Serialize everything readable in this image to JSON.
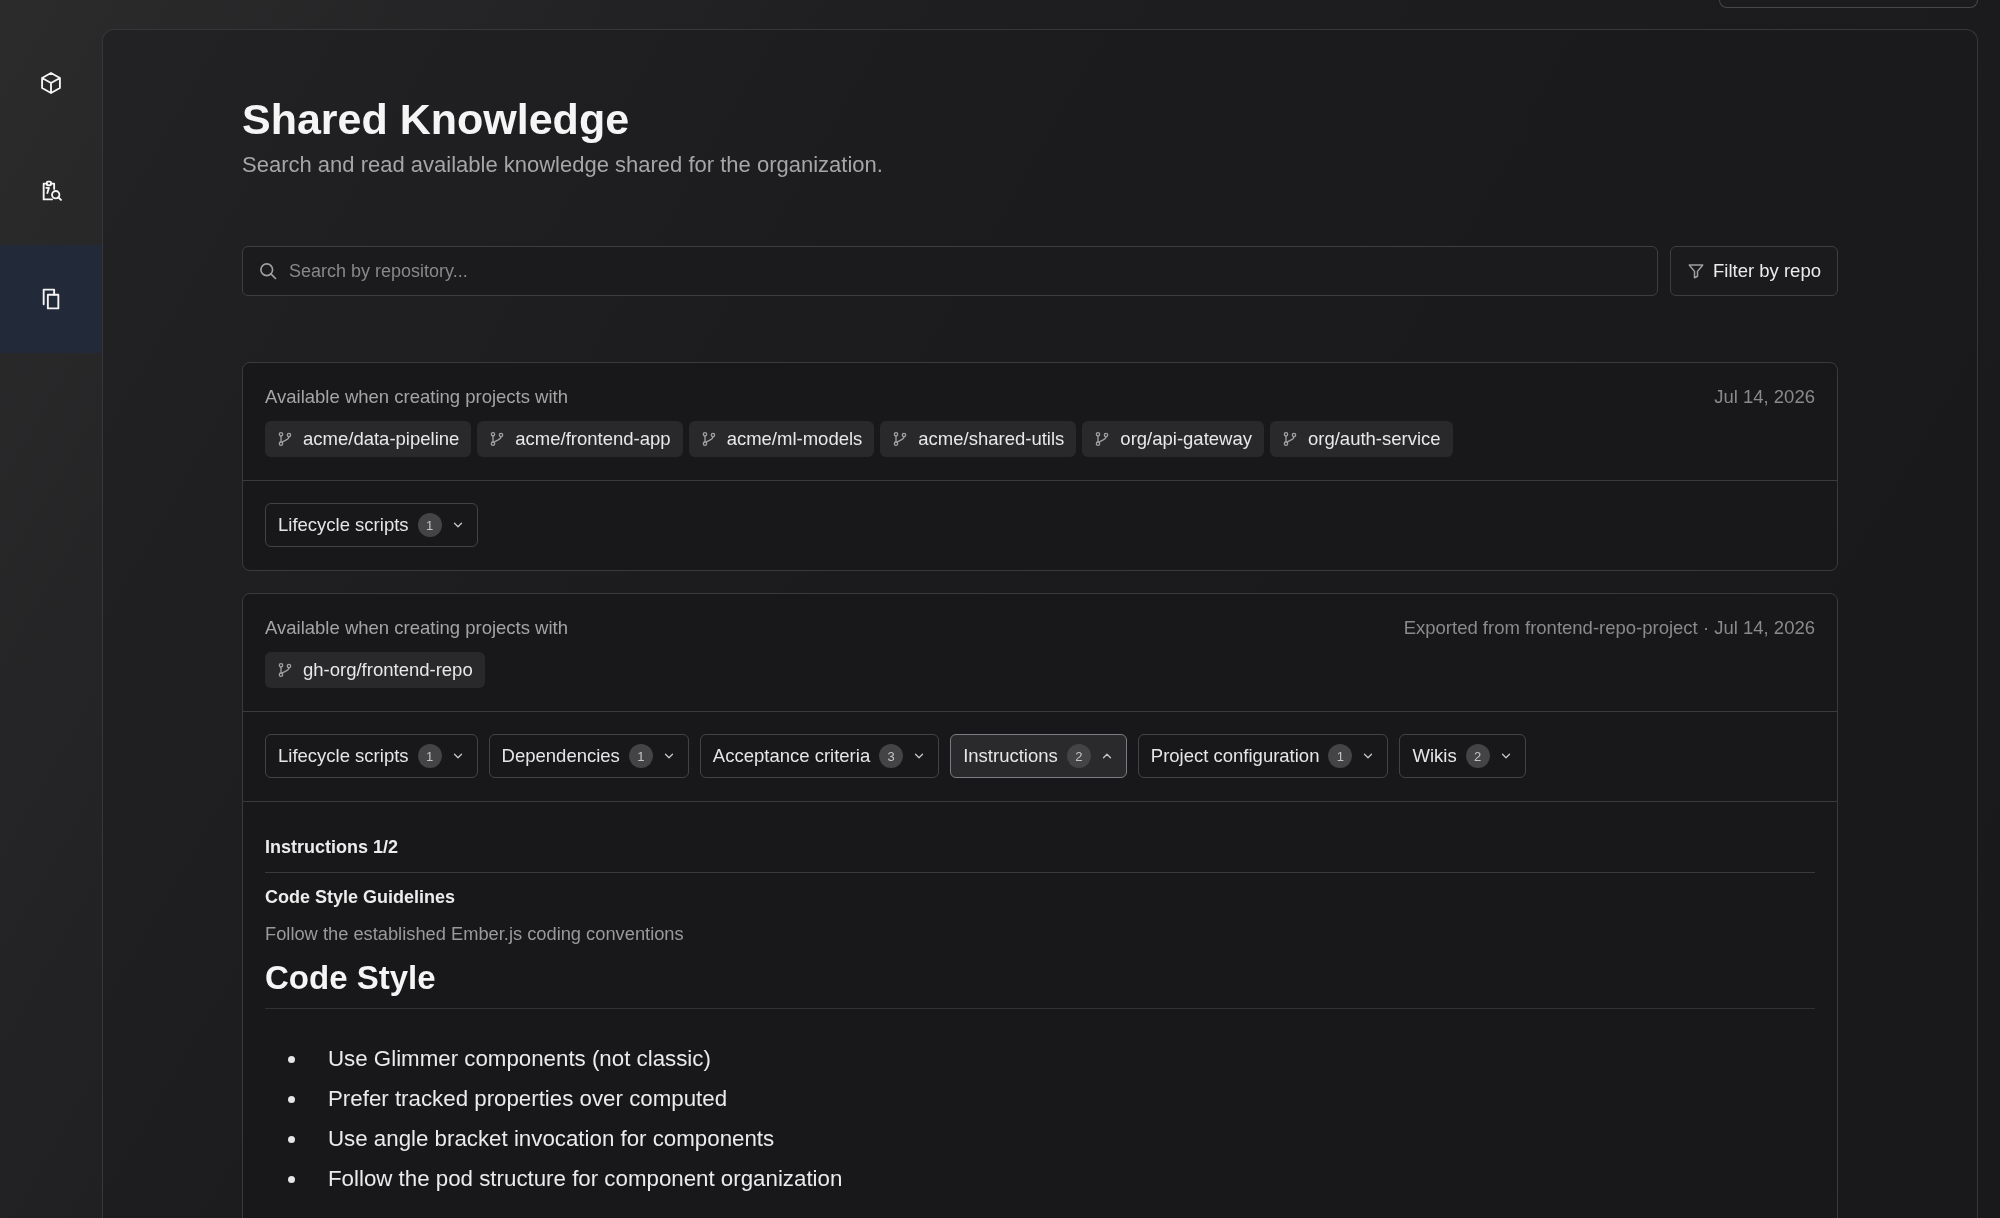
{
  "sidebar": {
    "items": [
      {
        "selected": false
      },
      {
        "selected": false
      },
      {
        "selected": true
      }
    ]
  },
  "header": {
    "title": "Shared Knowledge",
    "subtitle": "Search and read available knowledge shared for the organization."
  },
  "search": {
    "placeholder": "Search by repository..."
  },
  "filter_button": {
    "label": "Filter by repo"
  },
  "knowledge_sets": [
    {
      "availability_label": "Available when creating projects with",
      "meta": "Jul 14, 2026",
      "repositories": [
        "acme/data-pipeline",
        "acme/frontend-app",
        "acme/ml-models",
        "acme/shared-utils",
        "org/api-gateway",
        "org/auth-service"
      ],
      "sections": [
        {
          "label": "Lifecycle scripts",
          "count": "1",
          "expanded": false
        }
      ]
    },
    {
      "availability_label": "Available when creating projects with",
      "meta": "Exported from frontend-repo-project · Jul 14, 2026",
      "repositories": [
        "gh-org/frontend-repo"
      ],
      "sections": [
        {
          "label": "Lifecycle scripts",
          "count": "1",
          "expanded": false
        },
        {
          "label": "Dependencies",
          "count": "1",
          "expanded": false
        },
        {
          "label": "Acceptance criteria",
          "count": "3",
          "expanded": false
        },
        {
          "label": "Instructions",
          "count": "2",
          "expanded": true
        },
        {
          "label": "Project configuration",
          "count": "1",
          "expanded": false
        },
        {
          "label": "Wikis",
          "count": "2",
          "expanded": false
        }
      ],
      "expanded_panel": {
        "heading": "Instructions 1/2",
        "title": "Code Style Guidelines",
        "description": "Follow the established Ember.js coding conventions",
        "document": {
          "heading": "Code Style",
          "bullets": [
            "Use Glimmer components (not classic)",
            "Prefer tracked properties over computed",
            "Use angle bracket invocation for components",
            "Follow the pod structure for component organization"
          ]
        }
      }
    }
  ]
}
